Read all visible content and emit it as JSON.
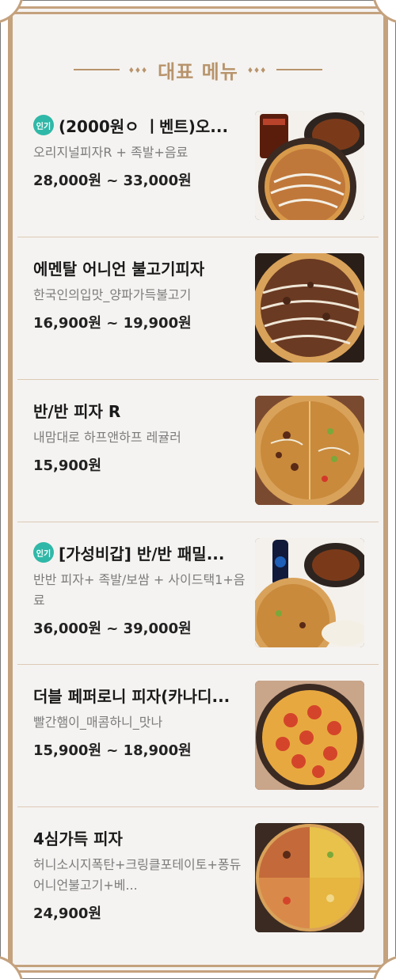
{
  "section": {
    "title": "대표 메뉴",
    "ornament": "♦♦♦"
  },
  "badge_label": "인기",
  "colors": {
    "accent": "#b8946c",
    "badge": "#2fb8a8",
    "card_bg": "#f5f3f1"
  },
  "items": [
    {
      "name": "(2000원ㅇ ㅣ벤트)오...",
      "desc": "오리지널피자R + 족발+음료",
      "price": "28,000원 ~ 33,000원",
      "popular": true,
      "thumb": "pizza-combo-cola-jokbal"
    },
    {
      "name": "에멘탈 어니언 불고기피자",
      "desc": "한국인의입맛_양파가득불고기",
      "price": "16,900원 ~ 19,900원",
      "popular": false,
      "thumb": "bulgogi-onion-pizza"
    },
    {
      "name": "반/반 피자 R",
      "desc": "내맘대로 하프앤하프 레귤러",
      "price": "15,900원",
      "popular": false,
      "thumb": "half-half-pizza"
    },
    {
      "name": "[가성비갑] 반/반 패밀...",
      "desc": "반반 피자+ 족발/보쌈 + 사이드택1+음료",
      "price": "36,000원 ~ 39,000원",
      "popular": true,
      "thumb": "family-combo-pepsi"
    },
    {
      "name": "더블 페퍼로니 피자(카나디...",
      "desc": "빨간햄이_매콤하니_맛나",
      "price": "15,900원 ~ 18,900원",
      "popular": false,
      "thumb": "pepperoni-pizza"
    },
    {
      "name": "4심가득 피자",
      "desc": "허니소시지폭탄+크링클포테이토+퐁듀어니언불고기+베...",
      "price": "24,900원",
      "popular": false,
      "thumb": "quarter-pizza"
    }
  ]
}
